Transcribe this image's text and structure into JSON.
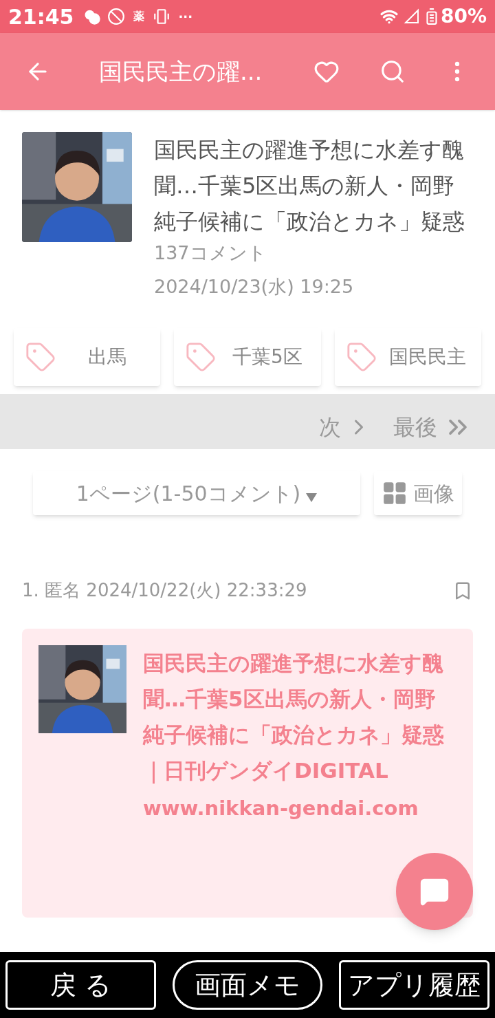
{
  "status_bar": {
    "time": "21:45",
    "medicine_label": "薬",
    "more": "···",
    "battery": "80%"
  },
  "app_bar": {
    "title": "国民民主の躍..."
  },
  "article": {
    "title": "国民民主の躍進予想に水差す醜聞…千葉5区出馬の新人・岡野純子候補に「政治とカネ」疑惑",
    "comment_count": "137コメント",
    "date": "2024/10/23(水) 19:25"
  },
  "tags": [
    {
      "label": "出馬"
    },
    {
      "label": "千葉5区"
    },
    {
      "label": "国民民主"
    }
  ],
  "pager": {
    "next": "次",
    "last": "最後"
  },
  "page_select": {
    "value": "1ページ(1-50コメント)",
    "images_button": "画像"
  },
  "comments": [
    {
      "header": "1. 匿名 2024/10/22(火) 22:33:29",
      "bookmarked": false,
      "link_card": {
        "title": "国民民主の躍進予想に水差す醜聞…千葉5区出馬の新人・岡野純子候補に「政治とカネ」疑惑｜日刊ゲンダイDIGITAL",
        "url": "www.nikkan-gendai.com"
      }
    }
  ],
  "nav_buttons": [
    {
      "label": "戻 る",
      "kind": "rect"
    },
    {
      "label": "画面メモ",
      "kind": "pill"
    },
    {
      "label": "アプリ履歴",
      "kind": "rect"
    }
  ]
}
